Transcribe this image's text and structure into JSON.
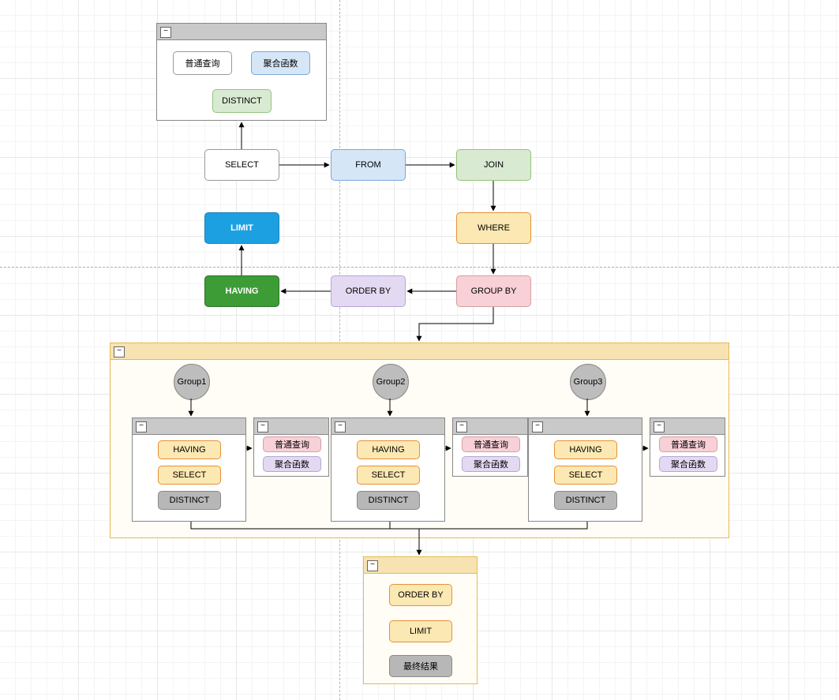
{
  "topContainer": {
    "items": {
      "normalQuery": "普通查询",
      "aggregate": "聚合函数",
      "distinct": "DISTINCT"
    }
  },
  "flow": {
    "select": "SELECT",
    "from": "FROM",
    "join": "JOIN",
    "limit": "LIMIT",
    "where": "WHERE",
    "having": "HAVING",
    "orderby": "ORDER BY",
    "groupby": "GROUP BY"
  },
  "groups": [
    {
      "circle": "Group1",
      "inner": {
        "having": "HAVING",
        "select": "SELECT",
        "distinct": "DISTINCT"
      },
      "side": {
        "normalQuery": "普通查询",
        "aggregate": "聚合函数"
      }
    },
    {
      "circle": "Group2",
      "inner": {
        "having": "HAVING",
        "select": "SELECT",
        "distinct": "DISTINCT"
      },
      "side": {
        "normalQuery": "普通查询",
        "aggregate": "聚合函数"
      }
    },
    {
      "circle": "Group3",
      "inner": {
        "having": "HAVING",
        "select": "SELECT",
        "distinct": "DISTINCT"
      },
      "side": {
        "normalQuery": "普通查询",
        "aggregate": "聚合函数"
      }
    }
  ],
  "bottomContainer": {
    "orderby": "ORDER BY",
    "limit": "LIMIT",
    "final": "最终结果"
  },
  "glyph": {
    "minus": "−"
  }
}
